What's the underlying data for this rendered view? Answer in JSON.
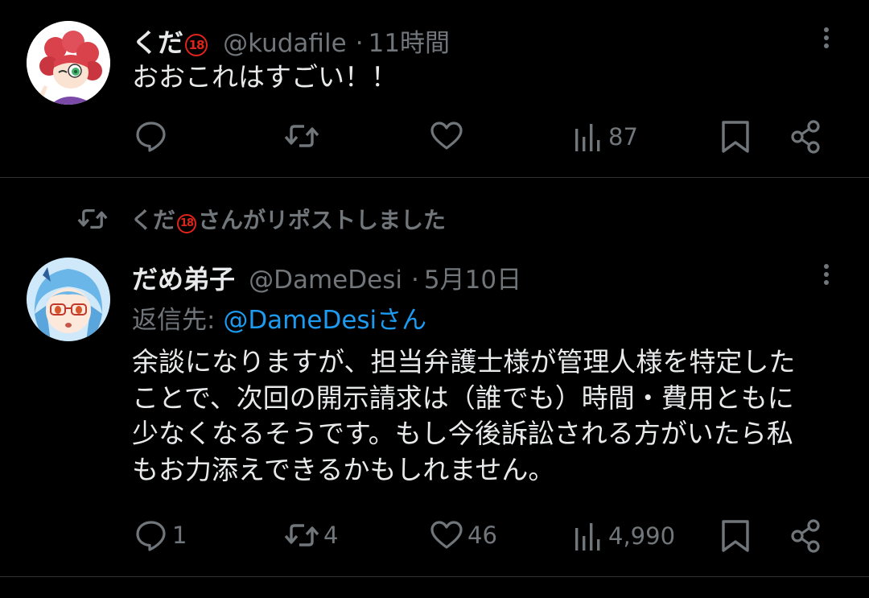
{
  "tweet1": {
    "display_name": "くだ",
    "badge": "18",
    "handle": "@kudafile",
    "separator": "·",
    "time": "11時間",
    "text": "おおこれはすごい！！",
    "actions": {
      "reply_count": "",
      "repost_count": "",
      "like_count": "",
      "views_count": "87"
    }
  },
  "repost_banner": {
    "name": "くだ",
    "badge": "18",
    "text": "さんがリポストしました"
  },
  "tweet2": {
    "display_name": "だめ弟子",
    "handle": "@DameDesi",
    "separator": "·",
    "time": "5月10日",
    "reply_prefix": "返信先: ",
    "reply_to": "@DameDesiさん",
    "lines": [
      "余談になりますが、担当弁護士様が管理人様を特定した",
      "ことで、次回の開示請求は（誰でも）時間・費用ともに",
      "少なくなるそうです。もし今後訴訟される方がいたら私",
      "もお力添えできるかもしれません。"
    ],
    "actions": {
      "reply_count": "1",
      "repost_count": "4",
      "like_count": "46",
      "views_count": "4,990"
    }
  },
  "colors": {
    "background": "#000000",
    "text": "#e7e9ea",
    "secondary": "#71767b",
    "link": "#1d9bf0",
    "divider": "#2f3336",
    "badge": "#e0241b"
  },
  "icons": [
    "reply-icon",
    "repost-icon",
    "like-icon",
    "views-icon",
    "bookmark-icon",
    "share-icon",
    "more-icon"
  ]
}
